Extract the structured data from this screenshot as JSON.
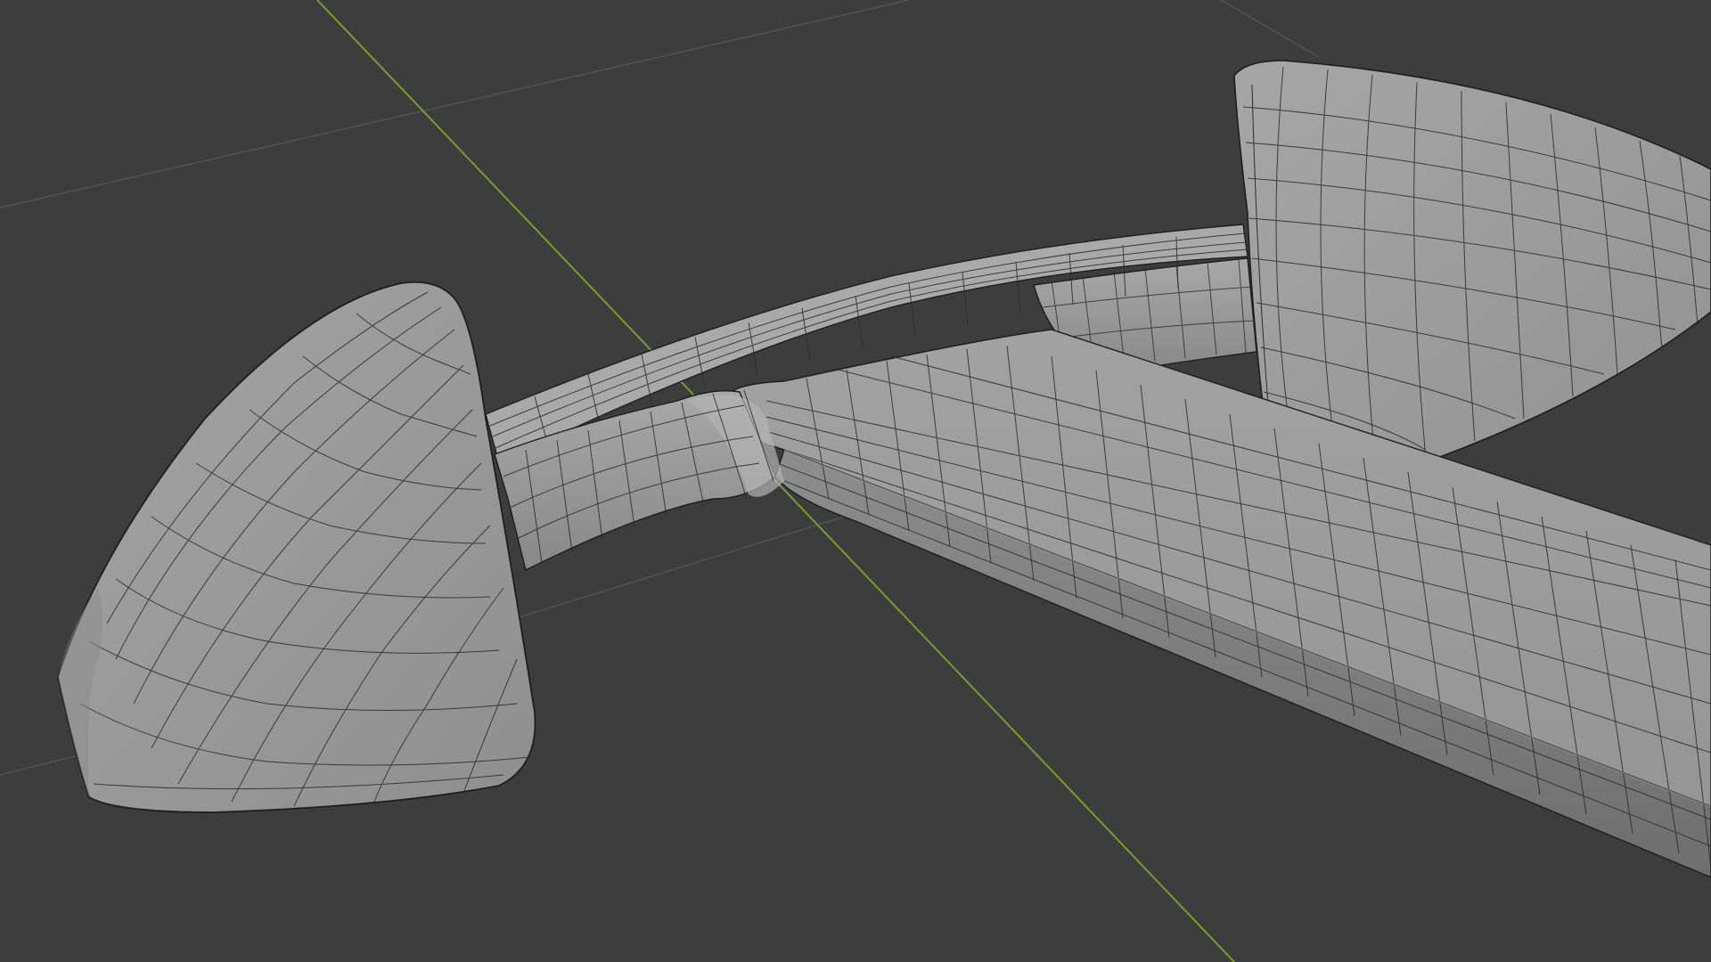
{
  "viewport": {
    "background_color": "#3d3d3d",
    "grid_line_color": "#525252",
    "y_axis_color": "#7c9a2c",
    "mesh_fill_color": "#9a9a9a",
    "mesh_shadow_color": "#737373",
    "wireframe_color": "#1e1e1e",
    "object": "anchor-mesh"
  }
}
